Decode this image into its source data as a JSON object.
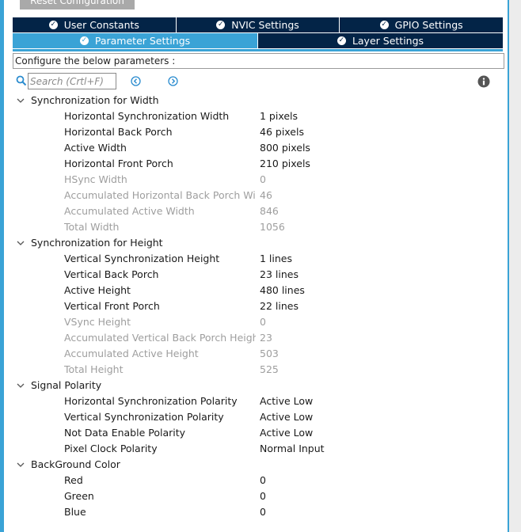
{
  "toolbar": {
    "reset_label": "Reset Configuration"
  },
  "tabs_row1": [
    {
      "label": "User Constants"
    },
    {
      "label": "NVIC Settings"
    },
    {
      "label": "GPIO Settings"
    }
  ],
  "tabs_row2": [
    {
      "label": "Parameter Settings",
      "active": true
    },
    {
      "label": "Layer Settings"
    }
  ],
  "configure_text": "Configure the below parameters :",
  "search": {
    "placeholder": "Search (Crtl+F)",
    "value": ""
  },
  "groups": [
    {
      "name": "Synchronization for Width",
      "params": [
        {
          "name": "Horizontal Synchronization Width",
          "value": "1 pixels",
          "readonly": false
        },
        {
          "name": "Horizontal Back Porch",
          "value": "46 pixels",
          "readonly": false
        },
        {
          "name": "Active Width",
          "value": "800 pixels",
          "readonly": false
        },
        {
          "name": "Horizontal Front Porch",
          "value": "210 pixels",
          "readonly": false
        },
        {
          "name": "HSync Width",
          "value": "0",
          "readonly": true
        },
        {
          "name": "Accumulated Horizontal Back Porch Wi...",
          "value": "46",
          "readonly": true
        },
        {
          "name": "Accumulated Active Width",
          "value": "846",
          "readonly": true
        },
        {
          "name": "Total Width",
          "value": "1056",
          "readonly": true
        }
      ]
    },
    {
      "name": "Synchronization for Height",
      "params": [
        {
          "name": "Vertical Synchronization Height",
          "value": "1 lines",
          "readonly": false
        },
        {
          "name": "Vertical Back Porch",
          "value": "23 lines",
          "readonly": false
        },
        {
          "name": "Active Height",
          "value": "480 lines",
          "readonly": false
        },
        {
          "name": "Vertical Front Porch",
          "value": "22 lines",
          "readonly": false
        },
        {
          "name": "VSync Height",
          "value": "0",
          "readonly": true
        },
        {
          "name": "Accumulated Vertical Back Porch Height",
          "value": "23",
          "readonly": true
        },
        {
          "name": "Accumulated Active Height",
          "value": "503",
          "readonly": true
        },
        {
          "name": "Total Height",
          "value": "525",
          "readonly": true
        }
      ]
    },
    {
      "name": "Signal Polarity",
      "params": [
        {
          "name": "Horizontal Synchronization Polarity",
          "value": "Active Low",
          "readonly": false
        },
        {
          "name": "Vertical Synchronization Polarity",
          "value": "Active Low",
          "readonly": false
        },
        {
          "name": "Not Data Enable Polarity",
          "value": "Active Low",
          "readonly": false
        },
        {
          "name": "Pixel Clock Polarity",
          "value": "Normal Input",
          "readonly": false
        }
      ]
    },
    {
      "name": "BackGround Color",
      "params": [
        {
          "name": "Red",
          "value": "0",
          "readonly": false
        },
        {
          "name": "Green",
          "value": "0",
          "readonly": false
        },
        {
          "name": "Blue",
          "value": "0",
          "readonly": false
        }
      ]
    }
  ]
}
